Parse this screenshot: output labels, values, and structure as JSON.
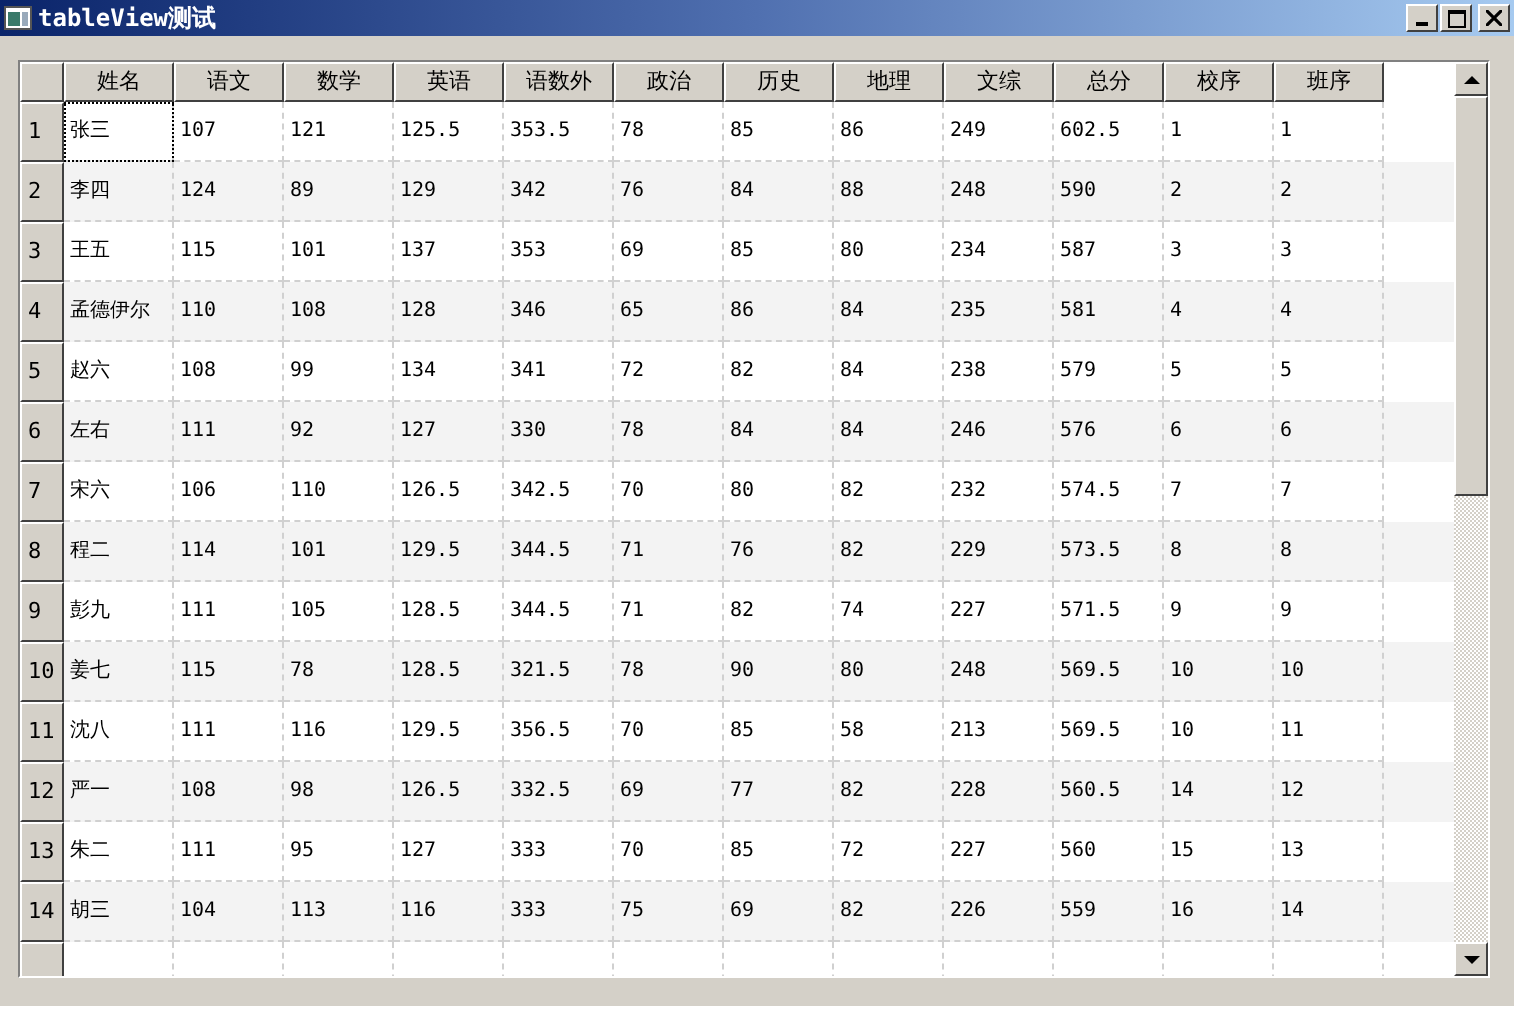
{
  "window": {
    "title": "tableView测试"
  },
  "table": {
    "columns": [
      "姓名",
      "语文",
      "数学",
      "英语",
      "语数外",
      "政治",
      "历史",
      "地理",
      "文综",
      "总分",
      "校序",
      "班序"
    ],
    "rows": [
      {
        "header": "1",
        "cells": [
          {
            "text": "张三",
            "focused": true
          },
          {
            "text": "107",
            "focused": false
          },
          {
            "text": "121",
            "focused": false
          },
          {
            "text": "125.5",
            "focused": false
          },
          {
            "text": "353.5",
            "focused": false
          },
          {
            "text": "78",
            "focused": false
          },
          {
            "text": "85",
            "focused": false
          },
          {
            "text": "86",
            "focused": false
          },
          {
            "text": "249",
            "focused": false
          },
          {
            "text": "602.5",
            "focused": false
          },
          {
            "text": "1",
            "focused": false
          },
          {
            "text": "1",
            "focused": false
          }
        ]
      },
      {
        "header": "2",
        "cells": [
          {
            "text": "李四",
            "focused": false
          },
          {
            "text": "124",
            "focused": false
          },
          {
            "text": "89",
            "focused": false
          },
          {
            "text": "129",
            "focused": false
          },
          {
            "text": "342",
            "focused": false
          },
          {
            "text": "76",
            "focused": false
          },
          {
            "text": "84",
            "focused": false
          },
          {
            "text": "88",
            "focused": false
          },
          {
            "text": "248",
            "focused": false
          },
          {
            "text": "590",
            "focused": false
          },
          {
            "text": "2",
            "focused": false
          },
          {
            "text": "2",
            "focused": false
          }
        ]
      },
      {
        "header": "3",
        "cells": [
          {
            "text": "王五",
            "focused": false
          },
          {
            "text": "115",
            "focused": false
          },
          {
            "text": "101",
            "focused": false
          },
          {
            "text": "137",
            "focused": false
          },
          {
            "text": "353",
            "focused": false
          },
          {
            "text": "69",
            "focused": false
          },
          {
            "text": "85",
            "focused": false
          },
          {
            "text": "80",
            "focused": false
          },
          {
            "text": "234",
            "focused": false
          },
          {
            "text": "587",
            "focused": false
          },
          {
            "text": "3",
            "focused": false
          },
          {
            "text": "3",
            "focused": false
          }
        ]
      },
      {
        "header": "4",
        "cells": [
          {
            "text": "孟德伊尔",
            "focused": false
          },
          {
            "text": "110",
            "focused": false
          },
          {
            "text": "108",
            "focused": false
          },
          {
            "text": "128",
            "focused": false
          },
          {
            "text": "346",
            "focused": false
          },
          {
            "text": "65",
            "focused": false
          },
          {
            "text": "86",
            "focused": false
          },
          {
            "text": "84",
            "focused": false
          },
          {
            "text": "235",
            "focused": false
          },
          {
            "text": "581",
            "focused": false
          },
          {
            "text": "4",
            "focused": false
          },
          {
            "text": "4",
            "focused": false
          }
        ]
      },
      {
        "header": "5",
        "cells": [
          {
            "text": "赵六",
            "focused": false
          },
          {
            "text": "108",
            "focused": false
          },
          {
            "text": "99",
            "focused": false
          },
          {
            "text": "134",
            "focused": false
          },
          {
            "text": "341",
            "focused": false
          },
          {
            "text": "72",
            "focused": false
          },
          {
            "text": "82",
            "focused": false
          },
          {
            "text": "84",
            "focused": false
          },
          {
            "text": "238",
            "focused": false
          },
          {
            "text": "579",
            "focused": false
          },
          {
            "text": "5",
            "focused": false
          },
          {
            "text": "5",
            "focused": false
          }
        ]
      },
      {
        "header": "6",
        "cells": [
          {
            "text": "左右",
            "focused": false
          },
          {
            "text": "111",
            "focused": false
          },
          {
            "text": "92",
            "focused": false
          },
          {
            "text": "127",
            "focused": false
          },
          {
            "text": "330",
            "focused": false
          },
          {
            "text": "78",
            "focused": false
          },
          {
            "text": "84",
            "focused": false
          },
          {
            "text": "84",
            "focused": false
          },
          {
            "text": "246",
            "focused": false
          },
          {
            "text": "576",
            "focused": false
          },
          {
            "text": "6",
            "focused": false
          },
          {
            "text": "6",
            "focused": false
          }
        ]
      },
      {
        "header": "7",
        "cells": [
          {
            "text": "宋六",
            "focused": false
          },
          {
            "text": "106",
            "focused": false
          },
          {
            "text": "110",
            "focused": false
          },
          {
            "text": "126.5",
            "focused": false
          },
          {
            "text": "342.5",
            "focused": false
          },
          {
            "text": "70",
            "focused": false
          },
          {
            "text": "80",
            "focused": false
          },
          {
            "text": "82",
            "focused": false
          },
          {
            "text": "232",
            "focused": false
          },
          {
            "text": "574.5",
            "focused": false
          },
          {
            "text": "7",
            "focused": false
          },
          {
            "text": "7",
            "focused": false
          }
        ]
      },
      {
        "header": "8",
        "cells": [
          {
            "text": "程二",
            "focused": false
          },
          {
            "text": "114",
            "focused": false
          },
          {
            "text": "101",
            "focused": false
          },
          {
            "text": "129.5",
            "focused": false
          },
          {
            "text": "344.5",
            "focused": false
          },
          {
            "text": "71",
            "focused": false
          },
          {
            "text": "76",
            "focused": false
          },
          {
            "text": "82",
            "focused": false
          },
          {
            "text": "229",
            "focused": false
          },
          {
            "text": "573.5",
            "focused": false
          },
          {
            "text": "8",
            "focused": false
          },
          {
            "text": "8",
            "focused": false
          }
        ]
      },
      {
        "header": "9",
        "cells": [
          {
            "text": "彭九",
            "focused": false
          },
          {
            "text": "111",
            "focused": false
          },
          {
            "text": "105",
            "focused": false
          },
          {
            "text": "128.5",
            "focused": false
          },
          {
            "text": "344.5",
            "focused": false
          },
          {
            "text": "71",
            "focused": false
          },
          {
            "text": "82",
            "focused": false
          },
          {
            "text": "74",
            "focused": false
          },
          {
            "text": "227",
            "focused": false
          },
          {
            "text": "571.5",
            "focused": false
          },
          {
            "text": "9",
            "focused": false
          },
          {
            "text": "9",
            "focused": false
          }
        ]
      },
      {
        "header": "10",
        "cells": [
          {
            "text": "姜七",
            "focused": false
          },
          {
            "text": "115",
            "focused": false
          },
          {
            "text": "78",
            "focused": false
          },
          {
            "text": "128.5",
            "focused": false
          },
          {
            "text": "321.5",
            "focused": false
          },
          {
            "text": "78",
            "focused": false
          },
          {
            "text": "90",
            "focused": false
          },
          {
            "text": "80",
            "focused": false
          },
          {
            "text": "248",
            "focused": false
          },
          {
            "text": "569.5",
            "focused": false
          },
          {
            "text": "10",
            "focused": false
          },
          {
            "text": "10",
            "focused": false
          }
        ]
      },
      {
        "header": "11",
        "cells": [
          {
            "text": "沈八",
            "focused": false
          },
          {
            "text": "111",
            "focused": false
          },
          {
            "text": "116",
            "focused": false
          },
          {
            "text": "129.5",
            "focused": false
          },
          {
            "text": "356.5",
            "focused": false
          },
          {
            "text": "70",
            "focused": false
          },
          {
            "text": "85",
            "focused": false
          },
          {
            "text": "58",
            "focused": false
          },
          {
            "text": "213",
            "focused": false
          },
          {
            "text": "569.5",
            "focused": false
          },
          {
            "text": "10",
            "focused": false
          },
          {
            "text": "11",
            "focused": false
          }
        ]
      },
      {
        "header": "12",
        "cells": [
          {
            "text": "严一",
            "focused": false
          },
          {
            "text": "108",
            "focused": false
          },
          {
            "text": "98",
            "focused": false
          },
          {
            "text": "126.5",
            "focused": false
          },
          {
            "text": "332.5",
            "focused": false
          },
          {
            "text": "69",
            "focused": false
          },
          {
            "text": "77",
            "focused": false
          },
          {
            "text": "82",
            "focused": false
          },
          {
            "text": "228",
            "focused": false
          },
          {
            "text": "560.5",
            "focused": false
          },
          {
            "text": "14",
            "focused": false
          },
          {
            "text": "12",
            "focused": false
          }
        ]
      },
      {
        "header": "13",
        "cells": [
          {
            "text": "朱二",
            "focused": false
          },
          {
            "text": "111",
            "focused": false
          },
          {
            "text": "95",
            "focused": false
          },
          {
            "text": "127",
            "focused": false
          },
          {
            "text": "333",
            "focused": false
          },
          {
            "text": "70",
            "focused": false
          },
          {
            "text": "85",
            "focused": false
          },
          {
            "text": "72",
            "focused": false
          },
          {
            "text": "227",
            "focused": false
          },
          {
            "text": "560",
            "focused": false
          },
          {
            "text": "15",
            "focused": false
          },
          {
            "text": "13",
            "focused": false
          }
        ]
      },
      {
        "header": "14",
        "cells": [
          {
            "text": "胡三",
            "focused": false
          },
          {
            "text": "104",
            "focused": false
          },
          {
            "text": "113",
            "focused": false
          },
          {
            "text": "116",
            "focused": false
          },
          {
            "text": "333",
            "focused": false
          },
          {
            "text": "75",
            "focused": false
          },
          {
            "text": "69",
            "focused": false
          },
          {
            "text": "82",
            "focused": false
          },
          {
            "text": "226",
            "focused": false
          },
          {
            "text": "559",
            "focused": false
          },
          {
            "text": "16",
            "focused": false
          },
          {
            "text": "14",
            "focused": false
          }
        ]
      }
    ]
  }
}
